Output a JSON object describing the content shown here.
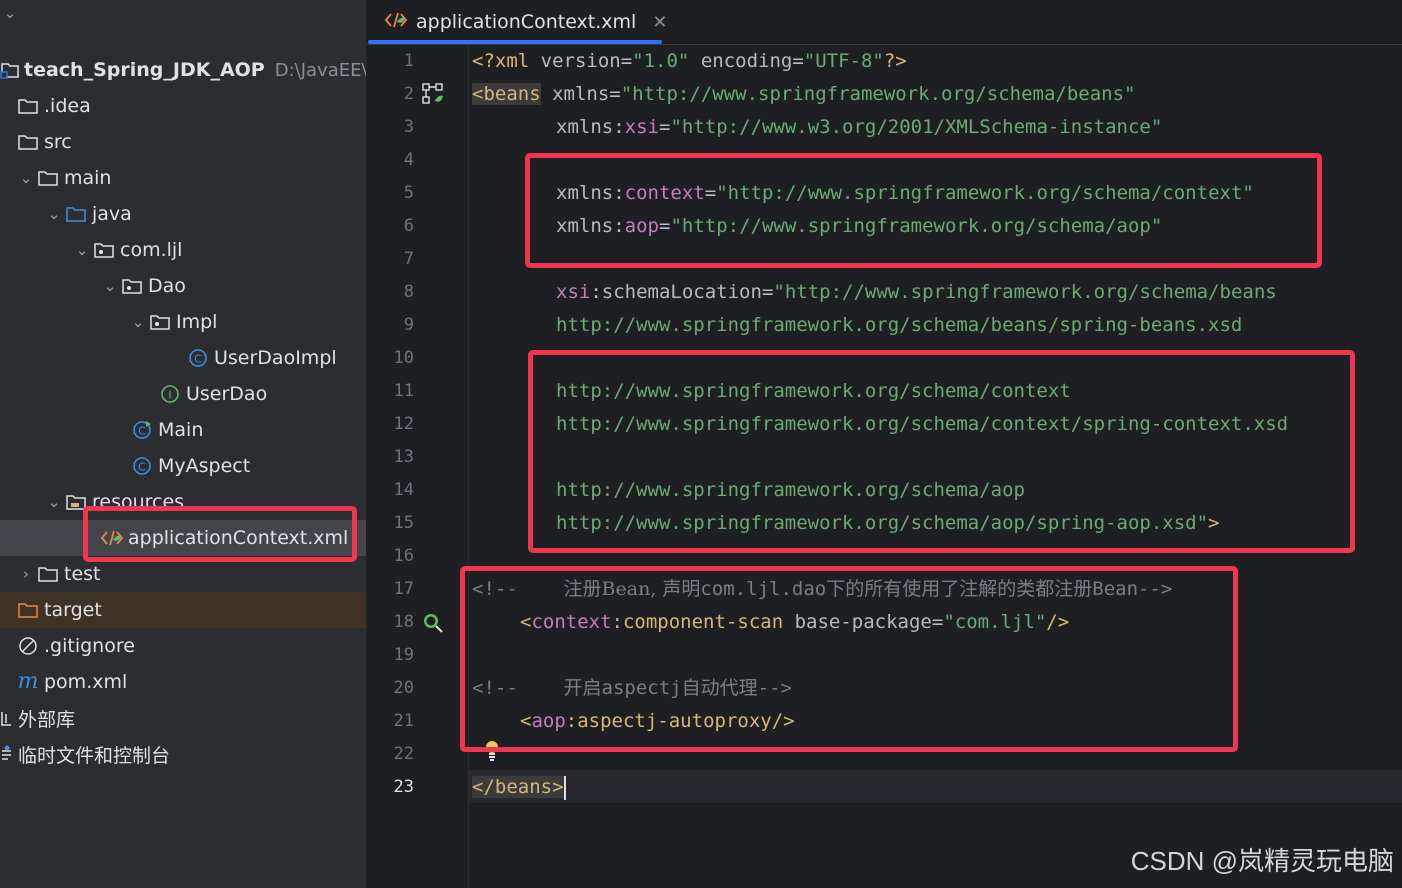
{
  "project_tree": {
    "root_name": "teach_Spring_JDK_AOP",
    "root_path": "D:\\JavaEE\\teach",
    "items": [
      {
        "label": "teach_Spring_JDK_AOP"
      },
      {
        "label": ".idea"
      },
      {
        "label": "src"
      },
      {
        "label": "main"
      },
      {
        "label": "java"
      },
      {
        "label": "com.ljl"
      },
      {
        "label": "Dao"
      },
      {
        "label": "Impl"
      },
      {
        "label": "UserDaoImpl"
      },
      {
        "label": "UserDao"
      },
      {
        "label": "Main"
      },
      {
        "label": "MyAspect"
      },
      {
        "label": "resources"
      },
      {
        "label": "applicationContext.xml"
      },
      {
        "label": "test"
      },
      {
        "label": "target"
      },
      {
        "label": ".gitignore"
      },
      {
        "label": "pom.xml"
      },
      {
        "label": "外部库"
      },
      {
        "label": "临时文件和控制台"
      }
    ]
  },
  "editor": {
    "tab_label": "applicationContext.xml",
    "current_line": 23,
    "line_numbers": [
      "1",
      "2",
      "3",
      "4",
      "5",
      "6",
      "7",
      "8",
      "9",
      "10",
      "11",
      "12",
      "13",
      "14",
      "15",
      "16",
      "17",
      "18",
      "19",
      "20",
      "21",
      "22",
      "23"
    ]
  },
  "code": {
    "l1": {
      "a": "<?xml ",
      "b": "version",
      "c": "=",
      "d": "\"1.0\"",
      "e": " encoding",
      "f": "=",
      "g": "\"UTF-8\"",
      "h": "?>"
    },
    "l2": {
      "tag": "<beans",
      "attr": " xmlns",
      "eq": "=",
      "str": "\"http://www.springframework.org/schema/beans\""
    },
    "l3": {
      "attr": "xmlns",
      "colon": ":",
      "ns": "xsi",
      "eq": "=",
      "str": "\"http://www.w3.org/2001/XMLSchema-instance\""
    },
    "l5": {
      "attr": "xmlns",
      "colon": ":",
      "ns": "context",
      "eq": "=",
      "str": "\"http://www.springframework.org/schema/context\""
    },
    "l6": {
      "attr": "xmlns",
      "colon": ":",
      "ns": "aop",
      "eq": "=",
      "str": "\"http://www.springframework.org/schema/aop\""
    },
    "l8": {
      "ns": "xsi",
      "colon": ":",
      "attr": "schemaLocation",
      "eq": "=",
      "str": "\"http://www.springframework.org/schema/beans"
    },
    "l9": {
      "str": "http://www.springframework.org/schema/beans/spring-beans.xsd"
    },
    "l11": {
      "str": "http://www.springframework.org/schema/context"
    },
    "l12": {
      "str": "http://www.springframework.org/schema/context/spring-context.xsd"
    },
    "l14": {
      "str": "http://www.springframework.org/schema/aop"
    },
    "l15": {
      "str": "http://www.springframework.org/schema/aop/spring-aop.xsd\"",
      "tag": ">"
    },
    "l17": {
      "open": "<!--",
      "text1": "注册Bean, 声明",
      "mono": "com.ljl.dao",
      "text2": "下的所有使用了注解的类都注册",
      "mono2": "Bean",
      "close": "-->"
    },
    "l18": {
      "lt": "<",
      "ns": "context",
      "colon": ":",
      "tag": "component-scan",
      "attr": " base-package",
      "eq": "=",
      "str": "\"com.ljl\"",
      "end": "/>"
    },
    "l20": {
      "open": "<!--",
      "text1": "开启",
      "mono": "aspectj",
      "text2": "自动代理",
      "close": "-->"
    },
    "l21": {
      "lt": "<",
      "ns": "aop",
      "colon": ":",
      "tag": "aspectj-autoproxy",
      "end": "/>"
    },
    "l23": {
      "tag": "</beans>"
    }
  },
  "watermark": "CSDN @岚精灵玩电脑",
  "colors": {
    "accent_tab": "#3574f0",
    "annotation_red": "#f0364e",
    "xml_string": "#6aab73",
    "xml_tag": "#d5b778",
    "xml_namespace": "#c77dbb"
  }
}
